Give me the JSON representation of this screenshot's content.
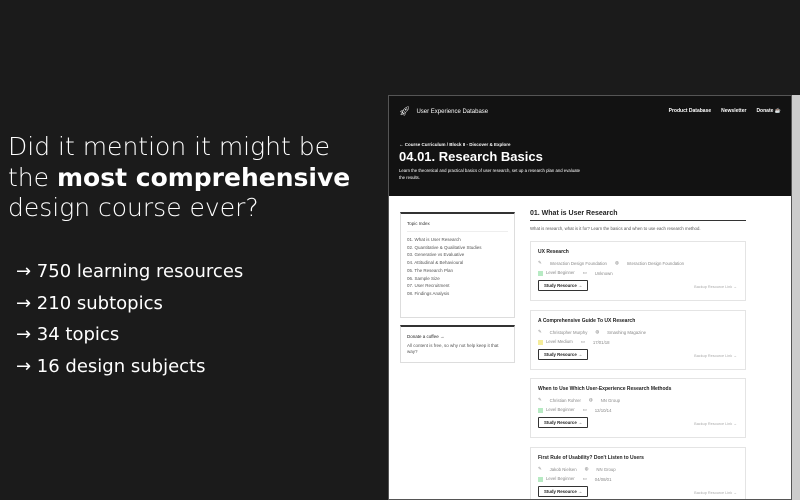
{
  "pitch": {
    "line1": "Did it mention it might be",
    "line2_pre": "the ",
    "line2_bold": "most comprehensive",
    "line3": "design course ever?"
  },
  "bullets": [
    "→ 750 learning resources",
    "→ 210 subtopics",
    "→ 34 topics",
    "→ 16 design subjects"
  ],
  "header": {
    "title": "User Experience Database",
    "nav": [
      "Product Database",
      "Newsletter",
      "Donate ☕"
    ],
    "breadcrumb": "← Course Curriculum  / Block II - Discover & Explore",
    "page_title": "04.01. Research Basics",
    "description": "Learn the theoretical and practical basics of user research, set up a research plan and evaluate the results."
  },
  "topic_index": {
    "title": "Topic Index",
    "items": [
      "01. What is User Research",
      "02. Quantitative & Qualitative Studies",
      "03. Generative vs Evaluative",
      "04. Attitudinal & Behavioural",
      "05. The Research Plan",
      "06. Sample Size",
      "07. User Recruitment",
      "08. Findings Analysis"
    ]
  },
  "donate": {
    "title": "Donate a coffee →",
    "text": "All content is free, so why not help keep it that way?"
  },
  "section": {
    "title": "01. What is User Research",
    "description": "What is research, what is it for? Learn the basics and when to use each research method."
  },
  "cards": [
    {
      "title": "UX Research",
      "author": "Interaction Design Foundation",
      "publisher": "Interaction Design Foundation",
      "level": "Level Beginner",
      "date": "Unknown",
      "level_color": "#b7eac3"
    },
    {
      "title": "A Comprehensive Guide To UX Research",
      "author": "Christopher Murphy",
      "publisher": "Smashing Magazine",
      "level": "Level Medium",
      "date": "17/01/18",
      "level_color": "#f5ec9a"
    },
    {
      "title": "When to Use Which User-Experience Research Methods",
      "author": "Christian Rohrer",
      "publisher": "NN Group",
      "level": "Level Beginner",
      "date": "12/10/14",
      "level_color": "#b7eac3"
    },
    {
      "title": "First Rule of Usability? Don't Listen to Users",
      "author": "Jakob Nielsen",
      "publisher": "NN Group",
      "level": "Level Beginner",
      "date": "04/08/01",
      "level_color": "#b7eac3"
    }
  ],
  "study_label": "Study Resource →",
  "backup_label": "Backup Resource Link →"
}
